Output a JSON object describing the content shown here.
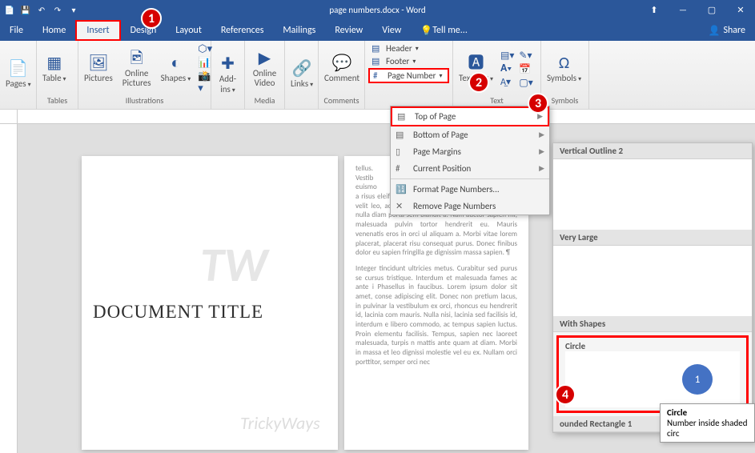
{
  "titlebar": {
    "title": "page numbers.docx - Word"
  },
  "window": {
    "min": "—",
    "restore": "❐",
    "max": "▢",
    "close": "✕",
    "ribbonmin": "⬆"
  },
  "tabs": [
    "File",
    "Home",
    "Insert",
    "Design",
    "Layout",
    "References",
    "Mailings",
    "Review",
    "View"
  ],
  "active_tab": "Insert",
  "tellme": "Tell me...",
  "share": "Share",
  "ribbon": {
    "pages": {
      "label": "Pages",
      "btn": "Pages"
    },
    "tables": {
      "label": "Tables",
      "btn": "Table"
    },
    "illus": {
      "label": "Illustrations",
      "pictures": "Pictures",
      "online_pic": "Online Pictures",
      "shapes": "Shapes",
      "smartart": "",
      "chart": "",
      "screenshot": ""
    },
    "addins": {
      "label": "",
      "btn": "Add-ins"
    },
    "media": {
      "label": "Media",
      "btn": "Online Video"
    },
    "links": {
      "btn": "Links"
    },
    "comments": {
      "label": "Comments",
      "btn": "Comment"
    },
    "hf": {
      "header": "Header",
      "footer": "Footer",
      "pagenum": "Page Number"
    },
    "text": {
      "label": "Text",
      "box": "Text Box"
    },
    "symbols": {
      "label": "Symbols",
      "btn": "Symbols"
    }
  },
  "submenu": {
    "top": "Top of Page",
    "bottom": "Bottom of Page",
    "margins": "Page Margins",
    "current": "Current Position",
    "format": "Format Page Numbers...",
    "remove": "Remove Page Numbers"
  },
  "gallery": {
    "vo2": "Vertical Outline 2",
    "vl": "Very Large",
    "ws": "With Shapes",
    "circle": "Circle",
    "rr": "ounded Rectangle 1",
    "circ_num": "1"
  },
  "tooltip": {
    "title": "Circle",
    "body": "Number inside shaded circ"
  },
  "doc": {
    "title": "DOCUMENT TITLE"
  },
  "lorem1": "Integer tincidunt ultricies metus. Curabitur sed purus se cursus tristique. Interdum et malesuada fames ac ante i Phasellus in faucibus. Lorem ipsum dolor sit amet, conse adipiscing elit. Donec non pretium lacus, in pulvinar la vestibulum ex orci, rhoncus eu hendrerit id, lacinia com mauris. Nulla nisi, lacinia sed facilisis id, interdum e libero commodo, ac tempus sapien luctus. Proin elementu facilisis. Tempus, sapien nec laoreet malesuada, turpis n mattis ante quam at diam. Morbi in massa et leo dignissi molestie vel eu ex. Nullam orci porttitor, semper orci nec",
  "lorem2": "tellus.\nVestib\neuismo\na risus eleifend, ac dignissim libero pretium. Nulla effi velit leo, ac porttitor nunc scelerisque. Nam aliquam nulla diam porta sem blandit a. Nam auctor sapien mi, malesuada pulvin tortor hendrerit eu. Mauris venenatis eros in orci ul aliquam a. Morbi vitae lorem placerat, placerat risu consequat purus. Donec finibus dolor eu sapien fringilla ge dignissim massa sapien. ¶",
  "watermark": "TW",
  "trickyways": "TrickyWays"
}
